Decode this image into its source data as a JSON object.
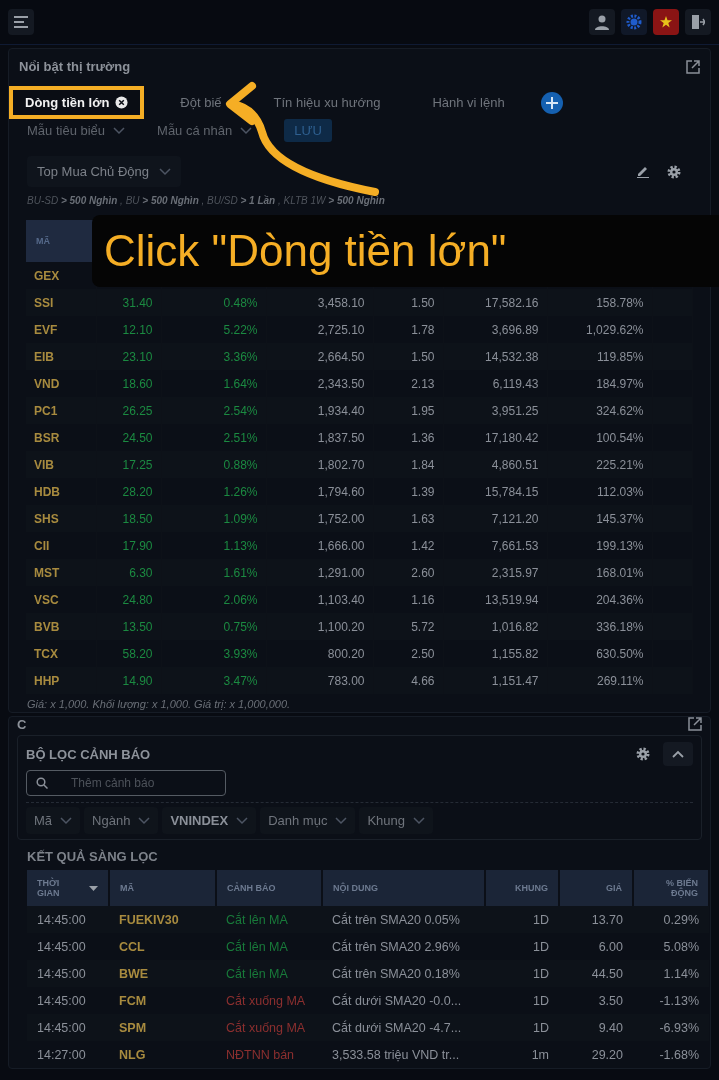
{
  "market_panel": {
    "title": "Nổi bật thị trường",
    "tabs": [
      {
        "label": "Dòng tiền lớn",
        "selected": true,
        "highlighted": true,
        "closable": true
      },
      {
        "label": "Đột biế",
        "selected": false,
        "highlighted": false,
        "closable": false
      },
      {
        "label": "Tín hiệu xu hướng",
        "selected": false,
        "highlighted": false,
        "closable": false
      },
      {
        "label": "Hành vi lệnh",
        "selected": false,
        "highlighted": false,
        "closable": false
      }
    ],
    "template_dropdowns": [
      "Mẫu tiêu biểu",
      "Mẫu cá nhân"
    ],
    "save_button": "LƯU",
    "screen_dropdown": "Top Mua Chủ Động",
    "filter_summary": "BU-SD **> 500 Nghìn** , BU **> 500 Nghìn** , BU/SD **> 1 Lần** , KLTB 1W **> 500 Nghìn**",
    "table": {
      "columns": [
        {
          "label": "MÃ",
          "selected": true
        }
      ],
      "rows": [
        {
          "cells": [
            "GEX"
          ]
        },
        {
          "cells": [
            "SSI",
            "31.40",
            "0.48%",
            "3,458.10",
            "1.50",
            "17,582.16",
            "158.78%"
          ]
        },
        {
          "cells": [
            "EVF",
            "12.10",
            "5.22%",
            "2,725.10",
            "1.78",
            "3,696.89",
            "1,029.62%"
          ]
        },
        {
          "cells": [
            "EIB",
            "23.10",
            "3.36%",
            "2,664.50",
            "1.50",
            "14,532.38",
            "119.85%"
          ]
        },
        {
          "cells": [
            "VND",
            "18.60",
            "1.64%",
            "2,343.50",
            "2.13",
            "6,119.43",
            "184.97%"
          ]
        },
        {
          "cells": [
            "PC1",
            "26.25",
            "2.54%",
            "1,934.40",
            "1.95",
            "3,951.25",
            "324.62%"
          ]
        },
        {
          "cells": [
            "BSR",
            "24.50",
            "2.51%",
            "1,837.50",
            "1.36",
            "17,180.42",
            "100.54%"
          ]
        },
        {
          "cells": [
            "VIB",
            "17.25",
            "0.88%",
            "1,802.70",
            "1.84",
            "4,860.51",
            "225.21%"
          ]
        },
        {
          "cells": [
            "HDB",
            "28.20",
            "1.26%",
            "1,794.60",
            "1.39",
            "15,784.15",
            "112.03%"
          ]
        },
        {
          "cells": [
            "SHS",
            "18.50",
            "1.09%",
            "1,752.00",
            "1.63",
            "7,121.20",
            "145.37%"
          ]
        },
        {
          "cells": [
            "CII",
            "17.90",
            "1.13%",
            "1,666.00",
            "1.42",
            "7,661.53",
            "199.13%"
          ]
        },
        {
          "cells": [
            "MST",
            "6.30",
            "1.61%",
            "1,291.00",
            "2.60",
            "2,315.97",
            "168.01%"
          ]
        },
        {
          "cells": [
            "VSC",
            "24.80",
            "2.06%",
            "1,103.40",
            "1.16",
            "13,519.94",
            "204.36%"
          ]
        },
        {
          "cells": [
            "BVB",
            "13.50",
            "0.75%",
            "1,100.20",
            "5.72",
            "1,016.82",
            "336.18%"
          ]
        },
        {
          "cells": [
            "TCX",
            "58.20",
            "3.93%",
            "800.20",
            "2.50",
            "1,155.82",
            "630.50%"
          ]
        },
        {
          "cells": [
            "HHP",
            "14.90",
            "3.47%",
            "783.00",
            "4.66",
            "1,151.47",
            "269.11%"
          ]
        }
      ]
    },
    "footnote": "Giá: x 1,000. Khối lượng: x 1,000. Giá trị: x 1,000,000."
  },
  "alert_panel": {
    "title": "C",
    "filter_card": {
      "title": "BỘ LỌC CẢNH BÁO",
      "search": {
        "placeholder": "Thêm cảnh báo"
      },
      "chips": [
        {
          "label": "Mã",
          "bold": false
        },
        {
          "label": "Ngành",
          "bold": false
        },
        {
          "label": "VNINDEX",
          "bold": true
        },
        {
          "label": "Danh mục",
          "bold": false
        },
        {
          "label": "Khung",
          "bold": false
        }
      ]
    },
    "results_title": "KẾT QUẢ SÀNG LỌC",
    "table": {
      "columns": [
        "THỜI GIAN",
        "MÃ",
        "CẢNH BÁO",
        "NỘI DUNG",
        "KHUNG",
        "GIÁ",
        "% BIẾN ĐỘNG"
      ],
      "rows": [
        {
          "kind": "up",
          "cells": [
            "14:45:00",
            "FUEKIV30",
            "Cắt lên MA",
            "Cắt trên SMA20 0.05%",
            "1D",
            "13.70",
            "0.29%"
          ]
        },
        {
          "kind": "up",
          "cells": [
            "14:45:00",
            "CCL",
            "Cắt lên MA",
            "Cắt trên SMA20 2.96%",
            "1D",
            "6.00",
            "5.08%"
          ]
        },
        {
          "kind": "up",
          "cells": [
            "14:45:00",
            "BWE",
            "Cắt lên MA",
            "Cắt trên SMA20 0.18%",
            "1D",
            "44.50",
            "1.14%"
          ]
        },
        {
          "kind": "down",
          "cells": [
            "14:45:00",
            "FCM",
            "Cắt xuống MA",
            "Cắt dưới SMA20 -0.0...",
            "1D",
            "3.50",
            "-1.13%"
          ]
        },
        {
          "kind": "down",
          "cells": [
            "14:45:00",
            "SPM",
            "Cắt xuống MA",
            "Cắt dưới SMA20 -4.7...",
            "1D",
            "9.40",
            "-6.93%"
          ]
        },
        {
          "kind": "down",
          "cells": [
            "14:27:00",
            "NLG",
            "NĐTNN bán",
            "3,533.58 triệu VND tr...",
            "1m",
            "29.20",
            "-1.68%"
          ]
        }
      ]
    }
  },
  "tutorial": {
    "callout": "Click \"Dòng tiền lớn\""
  }
}
